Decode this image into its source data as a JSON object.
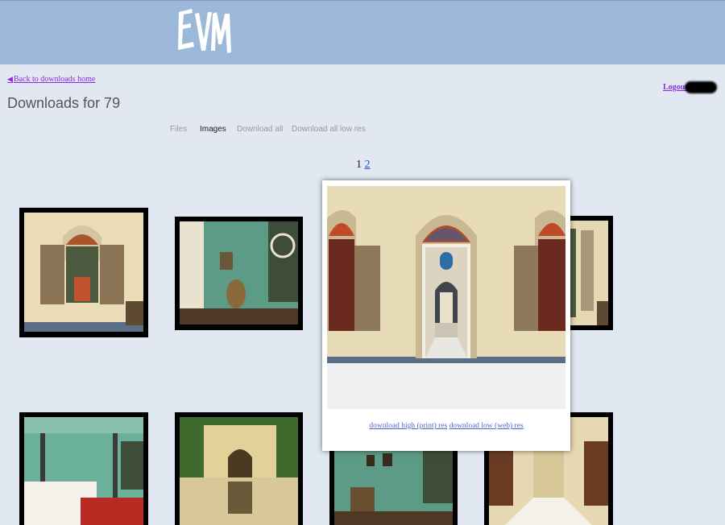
{
  "header": {
    "logo_text": "EVM"
  },
  "nav": {
    "back_label": "Back to downloads home",
    "back_arrow": "◀",
    "logout_label": "Logout"
  },
  "page": {
    "title": "Downloads for 79"
  },
  "tabs": [
    {
      "label": "Files",
      "active": false
    },
    {
      "label": "Images",
      "active": true
    },
    {
      "label": "Download all",
      "active": false
    },
    {
      "label": "Download all low res",
      "active": false
    }
  ],
  "pagination": {
    "current": "1",
    "next": "2"
  },
  "popup": {
    "link_high": "download high (print) res",
    "link_low": "download low (web) res"
  },
  "thumbnails": [
    {
      "subject": "arched window interior with shutters"
    },
    {
      "subject": "green room with armchair and lattice window"
    },
    {
      "subject": "arched doorways hallway"
    },
    {
      "subject": "bedroom with four-poster bed"
    },
    {
      "subject": "courtyard garden with arch"
    },
    {
      "subject": "green room with framed pictures"
    },
    {
      "subject": "corridor with bookshelves"
    }
  ],
  "colors": {
    "header_bg": "#9bb8d8",
    "page_bg": "#e1e8f2",
    "link_visited": "#8a2be2",
    "link": "#2255cc"
  }
}
